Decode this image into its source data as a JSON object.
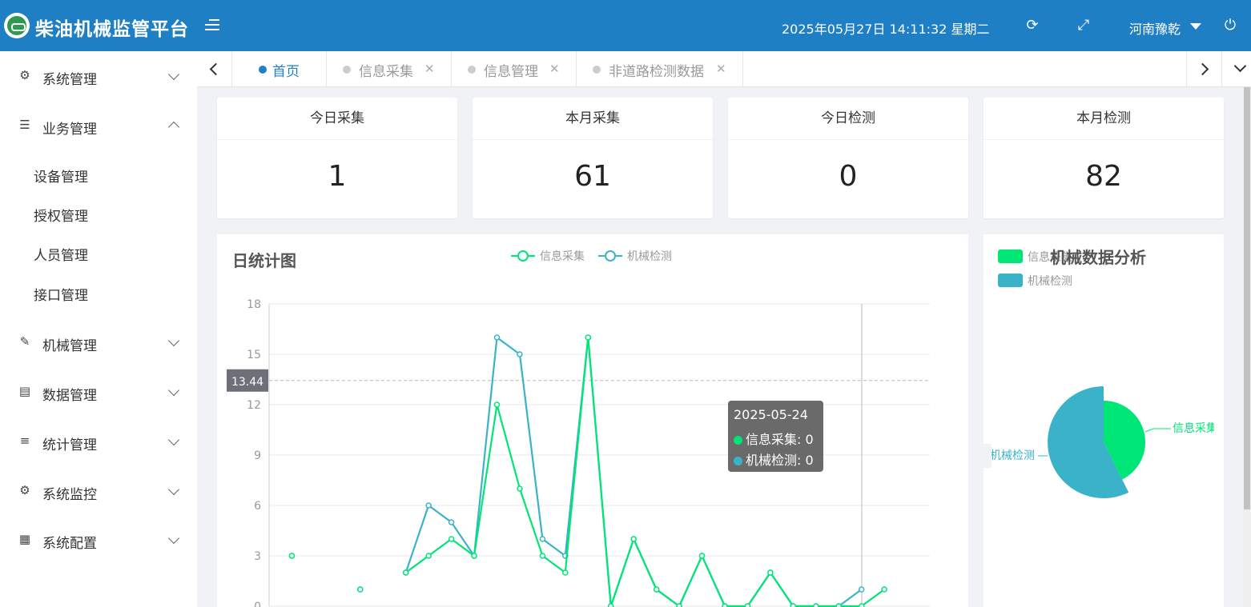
{
  "header": {
    "title": "柴油机械监管平台",
    "datetime": "2025年05月27日 14:11:32 星期二",
    "user": "河南豫乾",
    "logo_icon": "logo-emblem",
    "menu_icon": "menu-toggle-icon",
    "refresh_icon": "refresh-icon",
    "fullscreen_icon": "fullscreen-icon",
    "power_icon": "power-icon"
  },
  "sidebar": {
    "items": [
      {
        "label": "系统管理",
        "icon": "gear-icon",
        "glyph": "⚙"
      },
      {
        "label": "业务管理",
        "icon": "list-icon",
        "glyph": "☰"
      },
      {
        "label": "机械管理",
        "icon": "edit-icon",
        "glyph": "✎"
      },
      {
        "label": "数据管理",
        "icon": "document-icon",
        "glyph": "▤"
      },
      {
        "label": "统计管理",
        "icon": "stats-icon",
        "glyph": "≡"
      },
      {
        "label": "系统监控",
        "icon": "gears-icon",
        "glyph": "⚙"
      },
      {
        "label": "系统配置",
        "icon": "building-icon",
        "glyph": "▦"
      }
    ],
    "business_sub": [
      "设备管理",
      "授权管理",
      "人员管理",
      "接口管理"
    ]
  },
  "tabs": [
    {
      "label": "首页",
      "active": true
    },
    {
      "label": "信息采集",
      "active": false
    },
    {
      "label": "信息管理",
      "active": false
    },
    {
      "label": "非道路检测数据",
      "active": false
    }
  ],
  "cards": [
    {
      "title": "今日采集",
      "value": "1"
    },
    {
      "title": "本月采集",
      "value": "61"
    },
    {
      "title": "今日检测",
      "value": "0"
    },
    {
      "title": "本月检测",
      "value": "82"
    }
  ],
  "colors": {
    "primary": "#1f7fc5",
    "series_collect": "#00e676",
    "series_detect": "#3ab3c9"
  },
  "line_chart_title": "日统计图",
  "pie_chart_title": "机械数据分析",
  "tooltip": {
    "date": "2025-05-24",
    "row1": "信息采集: 0",
    "row2": "机械检测: 0"
  },
  "chart_data": [
    {
      "type": "line",
      "title": "日统计图",
      "ylim": [
        0,
        18
      ],
      "yticks": [
        0,
        3,
        6,
        9,
        12,
        15,
        18
      ],
      "crosshair_label": "13.44",
      "series": [
        {
          "name": "信息采集",
          "color": "#00e676",
          "values": [
            null,
            3,
            null,
            null,
            1,
            null,
            2,
            3,
            4,
            3,
            12,
            7,
            3,
            2,
            16,
            0,
            4,
            1,
            0,
            3,
            0,
            0,
            2,
            0,
            0,
            0,
            0,
            1
          ]
        },
        {
          "name": "机械检测",
          "color": "#3ab3c9",
          "values": [
            null,
            3,
            null,
            null,
            1,
            null,
            2,
            6,
            5,
            3,
            16,
            15,
            4,
            3,
            16,
            0,
            4,
            1,
            0,
            3,
            0,
            0,
            2,
            0,
            0,
            0,
            1,
            null
          ]
        }
      ],
      "grid": true,
      "legend": "top-center"
    },
    {
      "type": "pie",
      "title": "机械数据分析",
      "slices": [
        {
          "name": "信息采集",
          "value": 61,
          "color": "#00e676"
        },
        {
          "name": "机械检测",
          "value": 82,
          "color": "#3ab3c9"
        }
      ],
      "legend": "top-left"
    }
  ]
}
